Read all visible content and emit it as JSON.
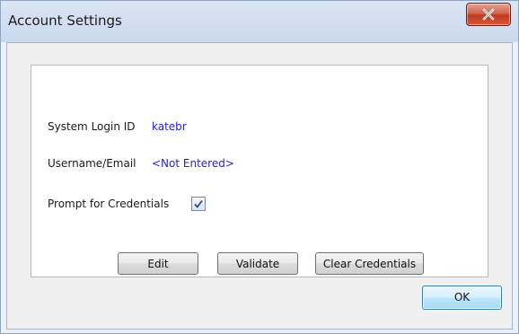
{
  "window": {
    "title": "Account Settings"
  },
  "fields": {
    "system_login_label": "System Login ID",
    "system_login_value": "katebr",
    "username_label": "Username/Email",
    "username_value": "<Not Entered>",
    "prompt_label": "Prompt for Credentials",
    "prompt_checked": true
  },
  "buttons": {
    "edit": "Edit",
    "validate": "Validate",
    "clear": "Clear Credentials",
    "ok": "OK"
  },
  "icons": {
    "close": "close-icon",
    "check": "checkmark-icon"
  },
  "colors": {
    "value_text": "#2323d6",
    "close_button": "#c1391f"
  }
}
